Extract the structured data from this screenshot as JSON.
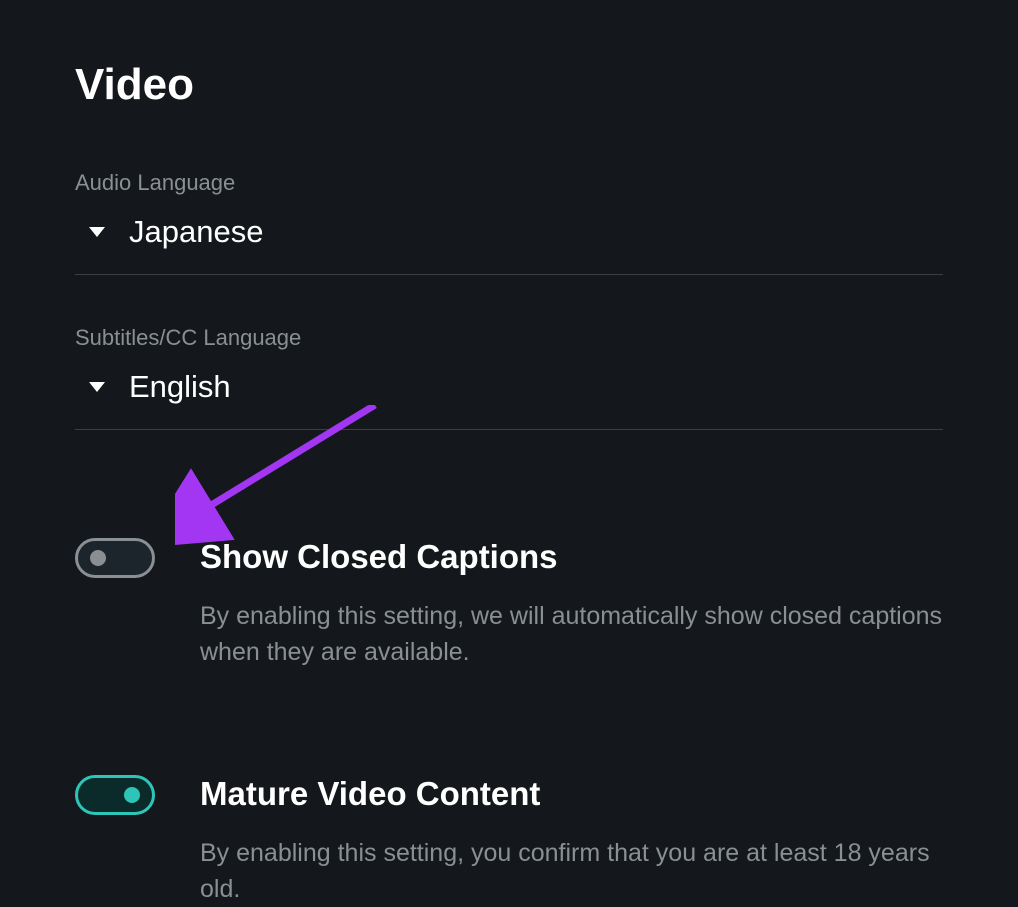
{
  "page_title": "Video",
  "audio_language": {
    "label": "Audio Language",
    "value": "Japanese"
  },
  "subtitles_language": {
    "label": "Subtitles/CC Language",
    "value": "English"
  },
  "closed_captions": {
    "title": "Show Closed Captions",
    "description": "By enabling this setting, we will automatically show closed captions when they are available.",
    "enabled": false
  },
  "mature_content": {
    "title": "Mature Video Content",
    "description": "By enabling this setting, you confirm that you are at least 18 years old.",
    "enabled": true
  },
  "colors": {
    "accent": "#2dc5b8",
    "pointer": "#a236f2"
  }
}
